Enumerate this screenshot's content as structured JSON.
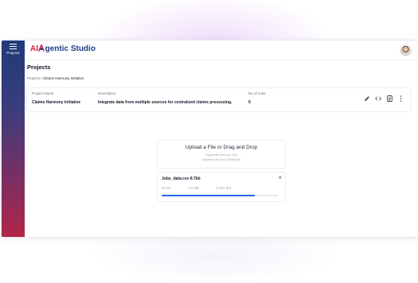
{
  "app": {
    "logo_prefix": "AI",
    "logo_rest": "gentic Studio",
    "brand_colors": {
      "red": "#c81e3a",
      "navy": "#1e3a8a"
    }
  },
  "sidebar": {
    "items": [
      {
        "label": "Projects",
        "icon": "menu-list-icon"
      }
    ]
  },
  "page": {
    "title": "Projects"
  },
  "breadcrumb": {
    "root": "Projects",
    "separator": "/",
    "current": "Claims Harmony Initiative"
  },
  "project": {
    "name_header": "Project Name",
    "name": "Claims Harmony Initiative",
    "description_header": "Description",
    "description": "Integrate data from multiple sources for centralized claims processing.",
    "jobs_header": "No of Jobs",
    "jobs": "0",
    "actions": [
      "pencil-icon",
      "code-icon",
      "document-icon",
      "more-vertical-icon"
    ]
  },
  "upload": {
    "title": "Upload a File or Drag and Drop",
    "supported": "Supported format: Csv",
    "max_size": "Maximum file size: 200MB per"
  },
  "file": {
    "name": "Jobs_data.csv 8.7kb",
    "type": "XLSX",
    "size": "7.2 MB",
    "time_left": "5 sec left",
    "progress_percent": 80,
    "progress_color": "#2563eb"
  }
}
